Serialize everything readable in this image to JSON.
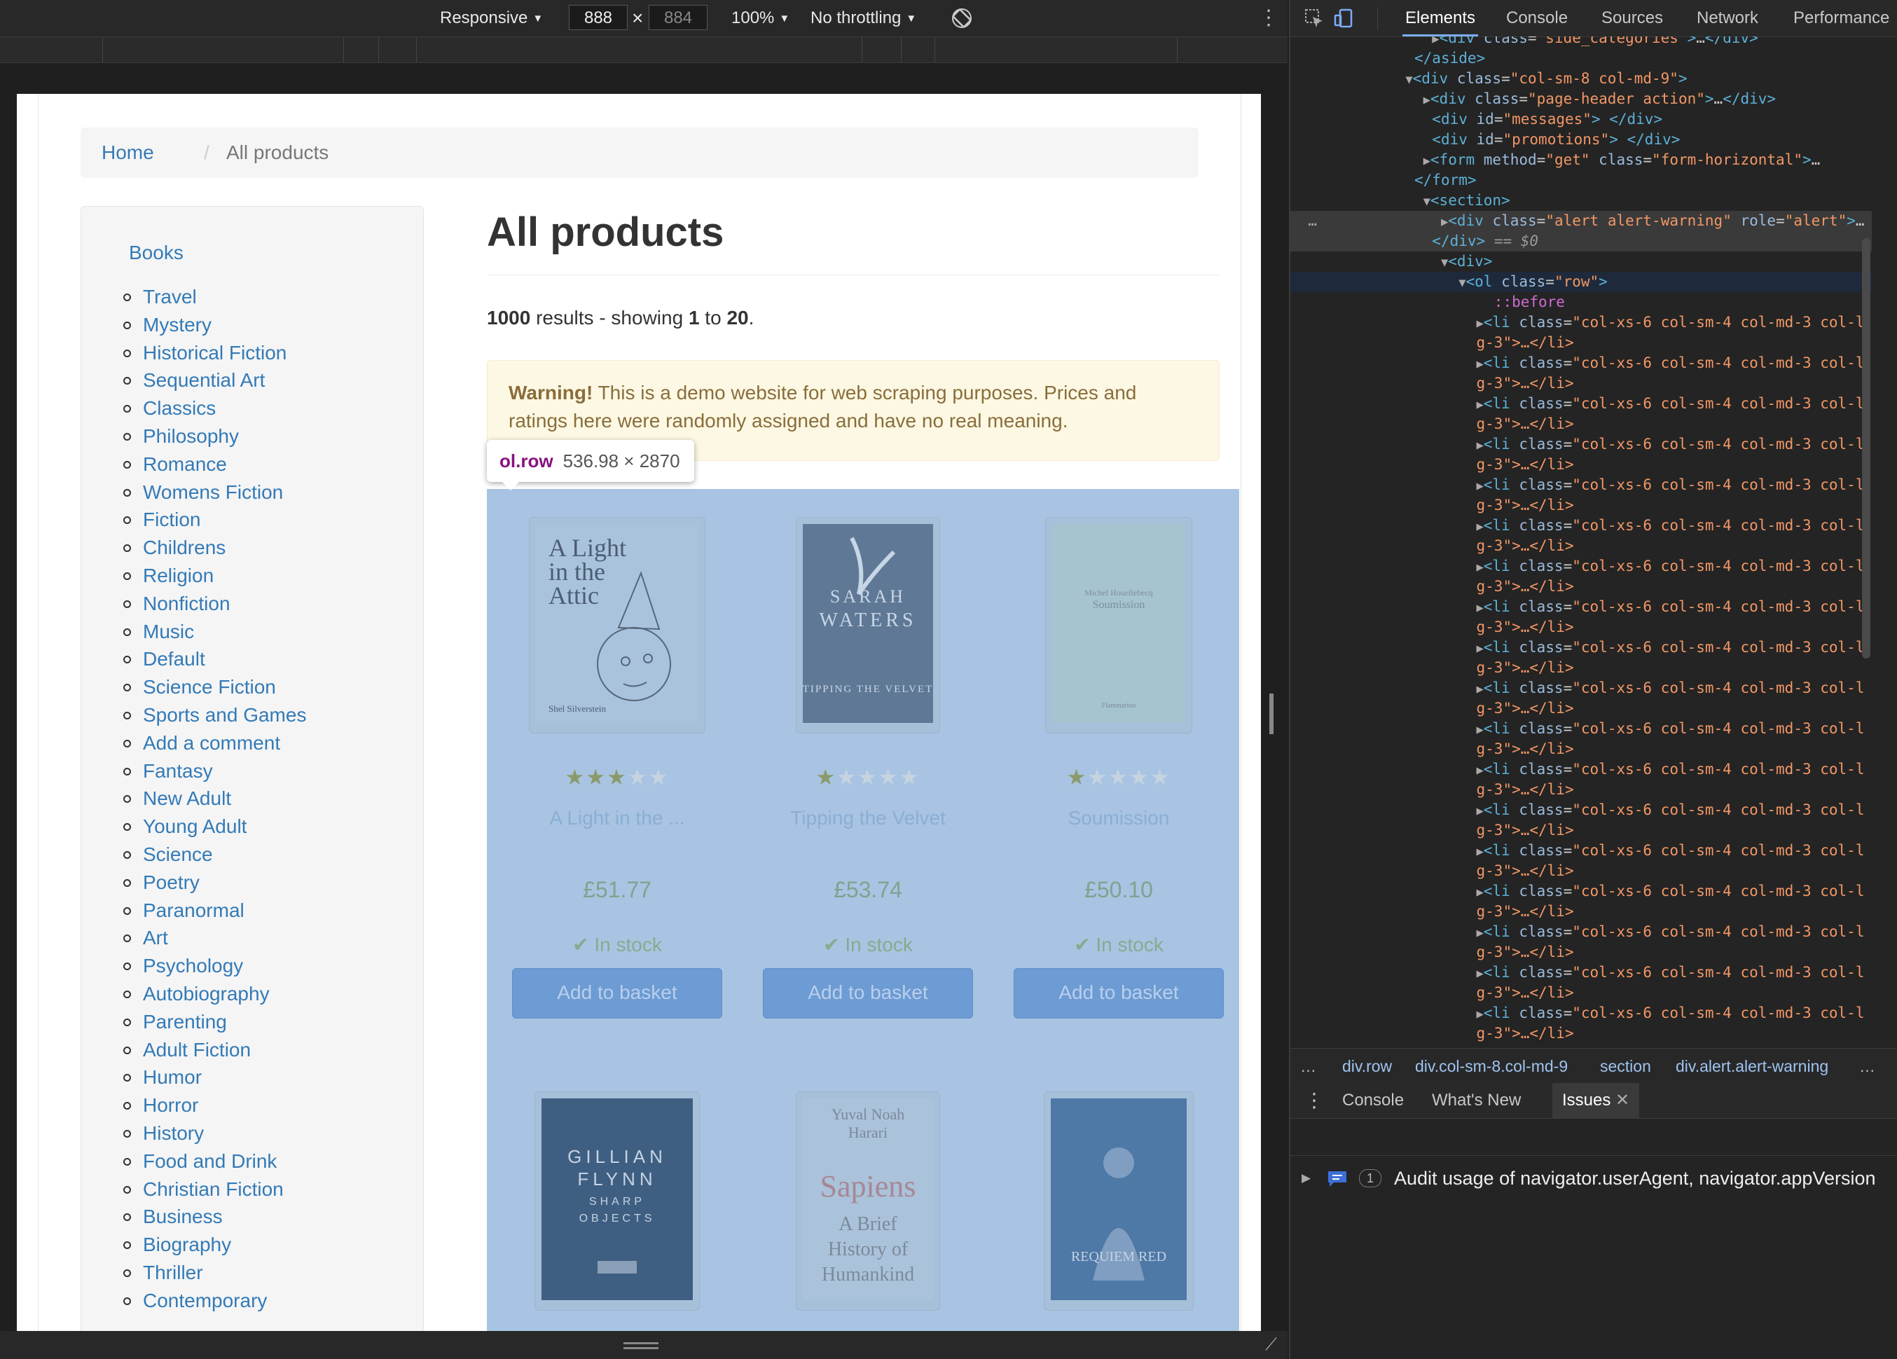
{
  "device_toolbar": {
    "device": "Responsive",
    "width": "888",
    "times": "×",
    "height": "884",
    "zoom": "100%",
    "throttling": "No throttling"
  },
  "page": {
    "breadcrumb": {
      "home": "Home",
      "separator": "/",
      "current": "All products"
    },
    "sidebar": {
      "heading": "Books",
      "categories": [
        "Travel",
        "Mystery",
        "Historical Fiction",
        "Sequential Art",
        "Classics",
        "Philosophy",
        "Romance",
        "Womens Fiction",
        "Fiction",
        "Childrens",
        "Religion",
        "Nonfiction",
        "Music",
        "Default",
        "Science Fiction",
        "Sports and Games",
        "Add a comment",
        "Fantasy",
        "New Adult",
        "Young Adult",
        "Science",
        "Poetry",
        "Paranormal",
        "Art",
        "Psychology",
        "Autobiography",
        "Parenting",
        "Adult Fiction",
        "Humor",
        "Horror",
        "History",
        "Food and Drink",
        "Christian Fiction",
        "Business",
        "Biography",
        "Thriller",
        "Contemporary"
      ]
    },
    "title": "All products",
    "results": {
      "count": "1000",
      "middle": " results - showing ",
      "from": "1",
      "to_word": " to ",
      "to": "20",
      "end": "."
    },
    "alert": {
      "strong": "Warning!",
      "text": " This is a demo website for web scraping purposes. Prices and ratings here were randomly assigned and have no real meaning."
    },
    "tooltip": {
      "tag": "ol.row",
      "size": "536.98 × 2870"
    },
    "products": [
      {
        "title": "A Light in the ...",
        "price": "£51.77",
        "rating": 3,
        "stock": "In stock",
        "button": "Add to basket",
        "cover": {
          "lines": [
            "A Light",
            "in the",
            "Attic"
          ],
          "author": "Shel Silverstein"
        }
      },
      {
        "title": "Tipping the Velvet",
        "price": "£53.74",
        "rating": 1,
        "stock": "In stock",
        "button": "Add to basket",
        "cover": {
          "lines": [
            "SARAH",
            "WATERS"
          ],
          "subtitle": "TIPPING THE VELVET"
        }
      },
      {
        "title": "Soumission",
        "price": "£50.10",
        "rating": 1,
        "stock": "In stock",
        "button": "Add to basket",
        "cover": {
          "lines": [
            "Michel Houellebecq",
            "Soumission"
          ],
          "publisher": "Flammarion"
        }
      }
    ],
    "row2_covers": [
      {
        "lines": [
          "GILLIAN",
          "FLYNN",
          "SHARP",
          "OBJECTS"
        ]
      },
      {
        "lines": [
          "Yuval Noah",
          "Harari",
          "Sapiens",
          "A Brief",
          "History of",
          "Humankind"
        ]
      },
      {
        "lines": [
          "REQUIEM RED"
        ]
      }
    ],
    "stars": {
      "on": "★",
      "off": "★"
    },
    "check": "✔"
  },
  "devtools": {
    "tabs": [
      "Elements",
      "Console",
      "Sources",
      "Network",
      "Performance"
    ],
    "breadcrumbs": [
      "div.row",
      "div.col-sm-8.col-md-9",
      "section",
      "div.alert.alert-warning"
    ],
    "drawer_tabs": [
      "Console",
      "What's New",
      "Issues"
    ],
    "issue": {
      "count": "1",
      "text": "Audit usage of navigator.userAgent, navigator.appVersion"
    },
    "dom_li_line": "col-xs-6 col-sm-4 col-md-3 col-l",
    "dom_li_tail": "g-3\">…</li>",
    "dollar": "== $0",
    "before": "::before"
  },
  "colors": {
    "link": "#337ab7",
    "overlay": "#a8c4e2",
    "alert_bg": "#fcf8e3",
    "devtools_bg": "#242424"
  }
}
